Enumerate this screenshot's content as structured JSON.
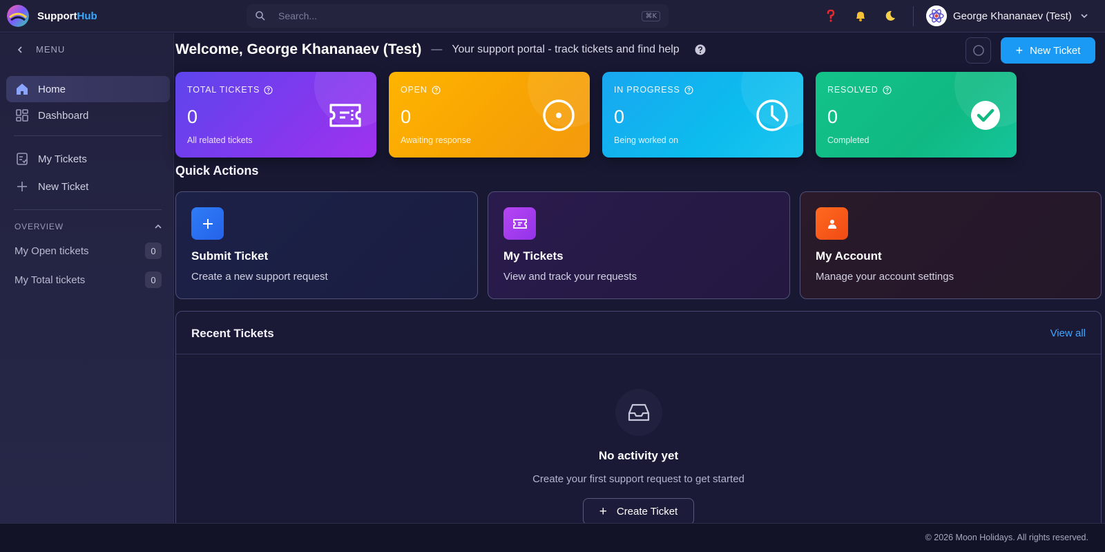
{
  "brand": {
    "name_main": "Support",
    "name_accent": "Hub"
  },
  "search": {
    "placeholder": "Search...",
    "shortcut": "⌘K"
  },
  "topbar": {
    "help_icon": "question-icon",
    "bell_icon": "bell-icon",
    "theme_icon": "moon-icon"
  },
  "user": {
    "name": "George Khananaev (Test)"
  },
  "sidebar": {
    "menu_label": "MENU",
    "items": [
      {
        "label": "Home",
        "icon": "home-icon",
        "active": true
      },
      {
        "label": "Dashboard",
        "icon": "grid-icon",
        "active": false
      },
      {
        "label": "My Tickets",
        "icon": "tickets-icon",
        "active": false
      },
      {
        "label": "New Ticket",
        "icon": "plus-icon",
        "active": false
      }
    ],
    "overview": {
      "label": "OVERVIEW",
      "items": [
        {
          "label": "My Open tickets",
          "count": "0"
        },
        {
          "label": "My Total tickets",
          "count": "0"
        }
      ]
    }
  },
  "header": {
    "title": "Welcome, George Khananaev (Test)",
    "separator": "—",
    "subtitle": "Your support portal - track tickets and find help",
    "new_ticket_label": "New Ticket"
  },
  "stats": [
    {
      "label": "TOTAL TICKETS",
      "value": "0",
      "desc": "All related tickets",
      "icon": "ticket-icon"
    },
    {
      "label": "OPEN",
      "value": "0",
      "desc": "Awaiting response",
      "icon": "target-circle-icon"
    },
    {
      "label": "IN PROGRESS",
      "value": "0",
      "desc": "Being worked on",
      "icon": "clock-icon"
    },
    {
      "label": "RESOLVED",
      "value": "0",
      "desc": "Completed",
      "icon": "check-circle-icon"
    }
  ],
  "quick_actions": {
    "title": "Quick Actions",
    "items": [
      {
        "title": "Submit Ticket",
        "desc": "Create a new support request",
        "icon": "plus-icon",
        "color": "#2f7cf6"
      },
      {
        "title": "My Tickets",
        "desc": "View and track your requests",
        "icon": "ticket-icon",
        "color": "#a63df0"
      },
      {
        "title": "My Account",
        "desc": "Manage your account settings",
        "icon": "user-icon",
        "color": "#fb5a1c"
      }
    ]
  },
  "recent": {
    "title": "Recent Tickets",
    "view_all": "View all",
    "empty_title": "No activity yet",
    "empty_sub": "Create your first support request to get started",
    "create_label": "Create Ticket"
  },
  "footer": {
    "copyright": "© 2026 Moon Holidays. All rights reserved."
  },
  "colors": {
    "accent": "#1a9af5",
    "link": "#3fa6ff",
    "background": "#181833"
  }
}
